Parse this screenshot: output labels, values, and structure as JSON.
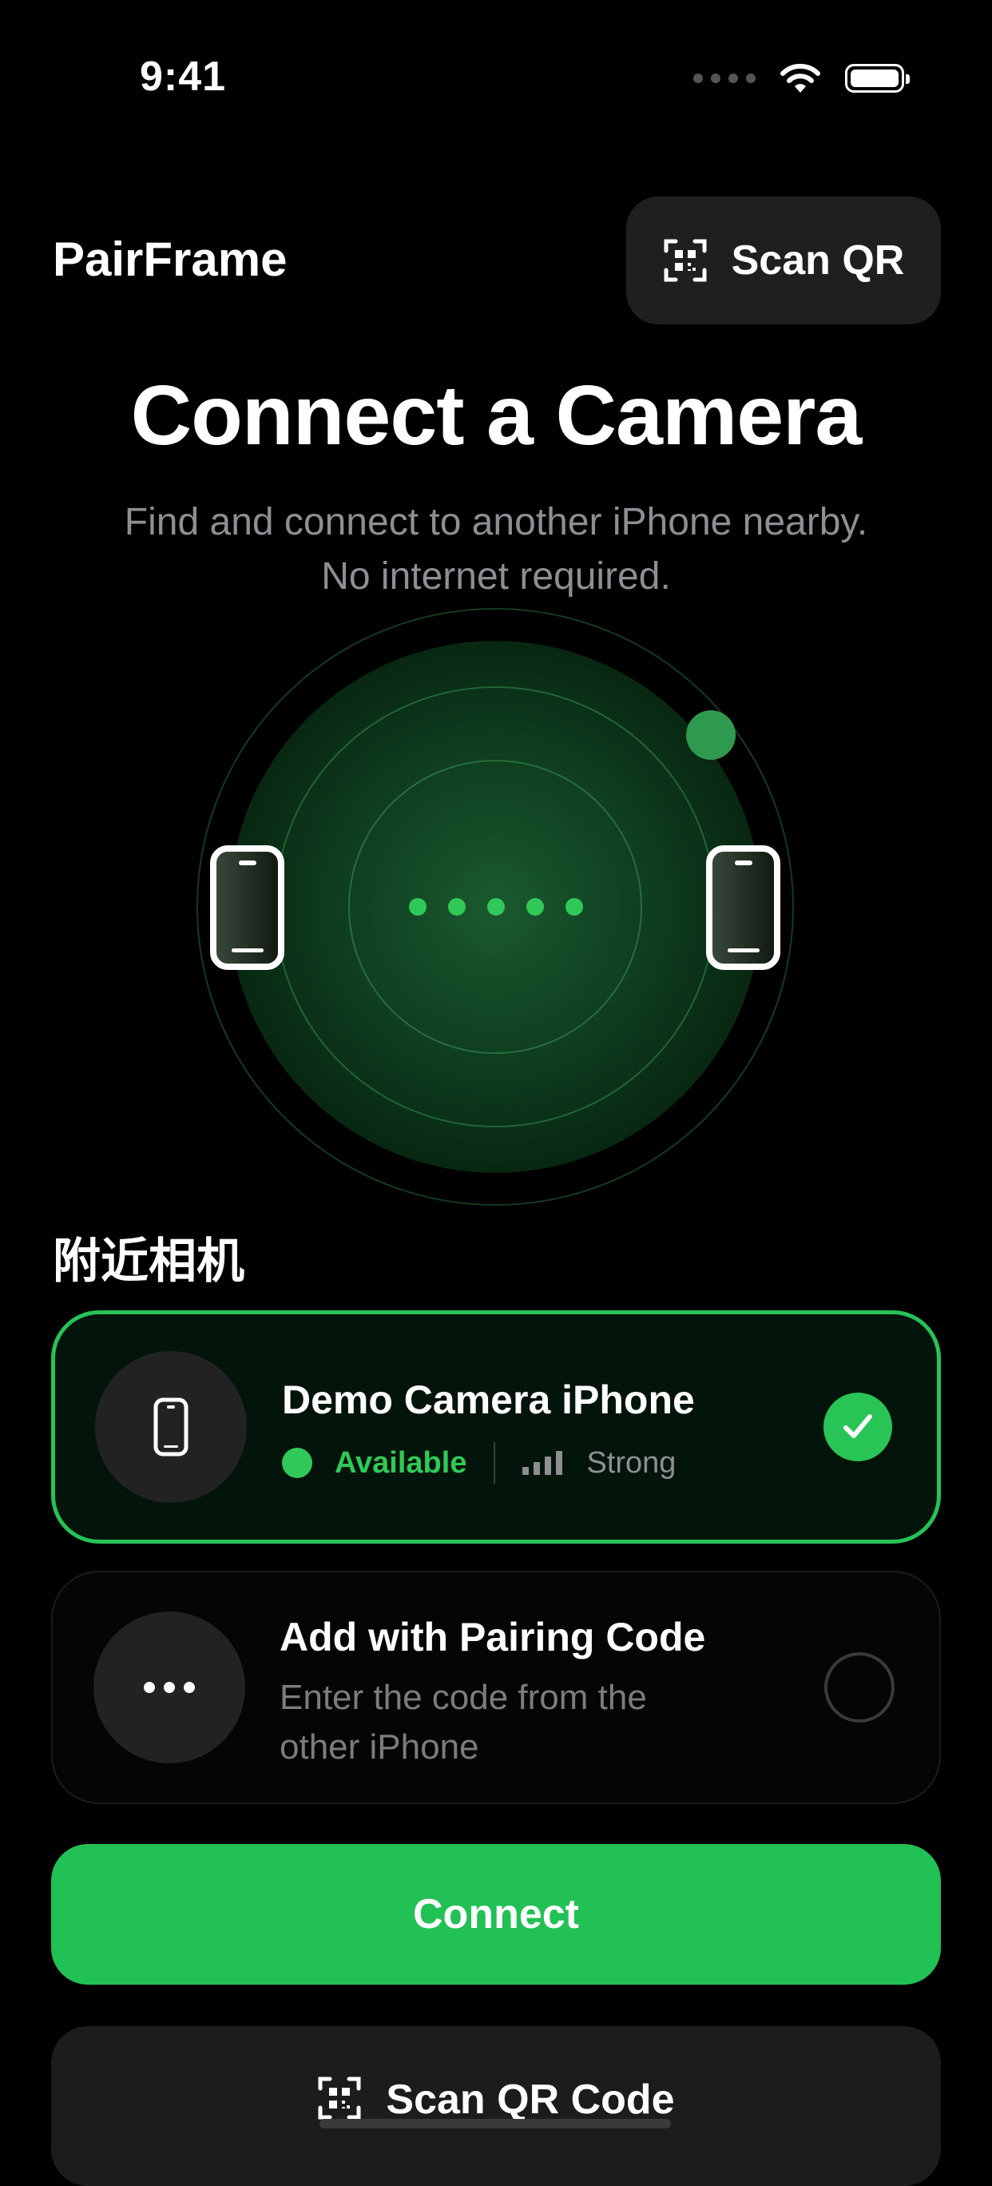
{
  "status_bar": {
    "time": "9:41",
    "icons": [
      "cellular-dots-icon",
      "wifi-icon",
      "battery-icon"
    ]
  },
  "header": {
    "app_title": "PairFrame",
    "scan_qr_label": "Scan QR",
    "scan_qr_icon": "qr-scan-icon"
  },
  "hero": {
    "headline": "Connect a Camera",
    "subtitle_line1": "Find and connect to another iPhone nearby.",
    "subtitle_line2": "No internet required."
  },
  "radar": {
    "left_device_icon": "iphone-icon",
    "right_device_icon": "iphone-icon",
    "progress_dots": 5
  },
  "nearby": {
    "section_title": "附近相机",
    "devices": [
      {
        "name": "Demo Camera iPhone",
        "status": "Available",
        "signal": "Strong",
        "selected": true,
        "icon": "iphone-icon"
      },
      {
        "name": "Add with Pairing Code",
        "description": "Enter the code from the other iPhone",
        "selected": false,
        "icon": "ellipsis-icon"
      }
    ]
  },
  "actions": {
    "connect_label": "Connect",
    "scan_code_label": "Scan QR Code"
  },
  "colors": {
    "accent_green": "#22c155",
    "background": "#000000",
    "card_dark": "#1f1f1f",
    "secondary_text": "#8e8e93"
  }
}
